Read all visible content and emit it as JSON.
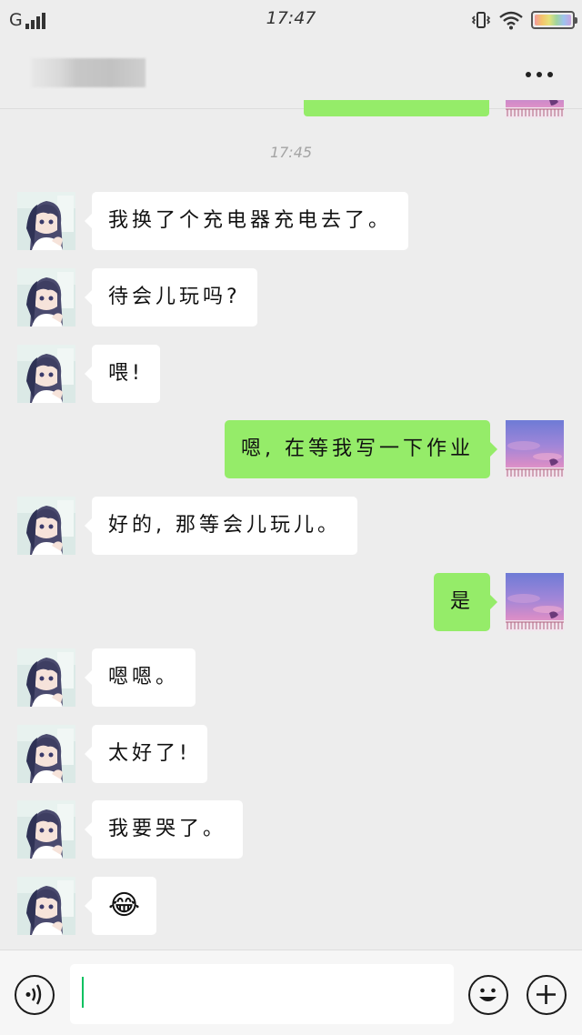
{
  "status_bar": {
    "carrier": "G",
    "time": "17:47",
    "signal_icon": "signal-bars-icon",
    "vibrate_icon": "vibrate-icon",
    "wifi_icon": "wifi-icon",
    "battery_icon": "battery-icon"
  },
  "header": {
    "contact_name_redacted": "",
    "more_icon": "more-dots-icon"
  },
  "chat": {
    "timestamp": "17:45",
    "messages": [
      {
        "side": "left",
        "text": "我换了个充电器充电去了。"
      },
      {
        "side": "left",
        "text": "待会儿玩吗?"
      },
      {
        "side": "left",
        "text": "喂!"
      },
      {
        "side": "right",
        "text": "嗯, 在等我写一下作业"
      },
      {
        "side": "left",
        "text": "好的, 那等会儿玩儿。"
      },
      {
        "side": "right",
        "text": "是"
      },
      {
        "side": "left",
        "text": "嗯嗯。"
      },
      {
        "side": "left",
        "text": "太好了!"
      },
      {
        "side": "left",
        "text": "我要哭了。"
      },
      {
        "side": "left",
        "text": "😂"
      }
    ]
  },
  "input_bar": {
    "voice_icon": "voice-icon",
    "input_value": "",
    "emoji_icon": "emoji-icon",
    "plus_icon": "plus-icon"
  },
  "colors": {
    "background": "#ededed",
    "outgoing_bubble": "#95ec69",
    "incoming_bubble": "#ffffff",
    "caret": "#07c160"
  }
}
